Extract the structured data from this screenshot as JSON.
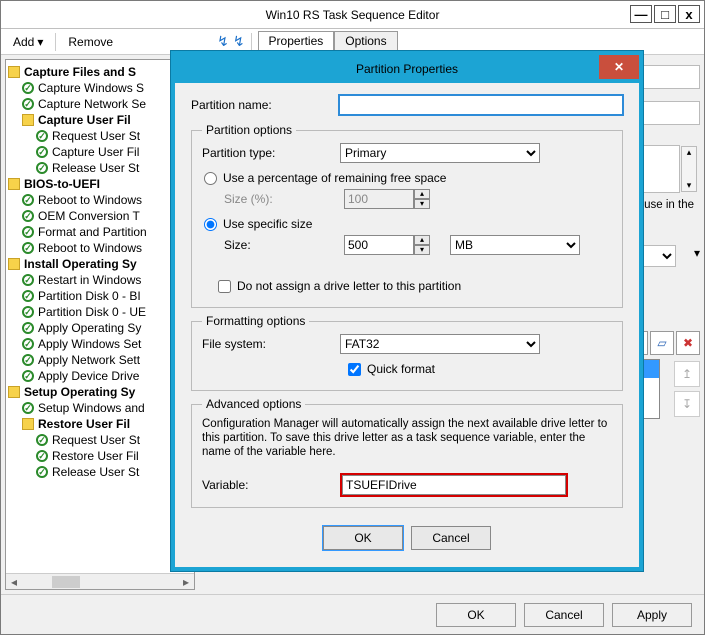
{
  "window": {
    "title": "Win10 RS Task Sequence Editor",
    "min": "—",
    "max": "□",
    "close": "x"
  },
  "toolbar": {
    "add": "Add",
    "remove": "Remove",
    "tabs": {
      "properties": "Properties",
      "options": "Options"
    }
  },
  "tree": {
    "g1": "Capture Files and S",
    "g1_items": [
      "Capture Windows S",
      "Capture Network Se"
    ],
    "g1a": "Capture User Fil",
    "g1a_items": [
      "Request User St",
      "Capture User Fil",
      "Release User St"
    ],
    "g2": "BIOS-to-UEFI",
    "g2_items": [
      "Reboot to Windows",
      "OEM Conversion T",
      "Format and Partition",
      "Reboot to Windows"
    ],
    "g3": "Install Operating Sy",
    "g3_items": [
      "Restart in Windows",
      "Partition Disk 0 - BI",
      "Partition Disk 0 - UE",
      "Apply Operating Sy",
      "Apply Windows Set",
      "Apply Network Sett",
      "Apply Device Drive"
    ],
    "g4": "Setup Operating Sy",
    "g4_items": [
      "Setup Windows and"
    ],
    "g4a": "Restore User Fil",
    "g4a_items": [
      "Request User St",
      "Restore User Fil",
      "Release User St"
    ]
  },
  "right": {
    "hint": "layout to use in the",
    "icons": {
      "new": "✳",
      "props": "▱",
      "del": "✖",
      "up": "▲",
      "down": "▼"
    }
  },
  "buttons": {
    "ok": "OK",
    "cancel": "Cancel",
    "apply": "Apply"
  },
  "dialog": {
    "title": "Partition Properties",
    "name_lbl": "Partition name:",
    "name_val": "",
    "opts_legend": "Partition options",
    "type_lbl": "Partition type:",
    "type_val": "Primary",
    "radio_pct": "Use a percentage of remaining free space",
    "size_pct_lbl": "Size (%):",
    "size_pct_val": "100",
    "radio_fixed": "Use specific size",
    "size_lbl": "Size:",
    "size_val": "500",
    "size_unit": "MB",
    "no_letter": "Do not assign a drive letter to this partition",
    "fmt_legend": "Formatting options",
    "fs_lbl": "File system:",
    "fs_val": "FAT32",
    "quick": "Quick format",
    "adv_legend": "Advanced options",
    "adv_text": "Configuration Manager will automatically assign the next available drive letter to this partition. To save this drive letter as a task sequence variable, enter the name of the variable here.",
    "var_lbl": "Variable:",
    "var_val": "TSUEFIDrive",
    "ok": "OK",
    "cancel": "Cancel"
  }
}
